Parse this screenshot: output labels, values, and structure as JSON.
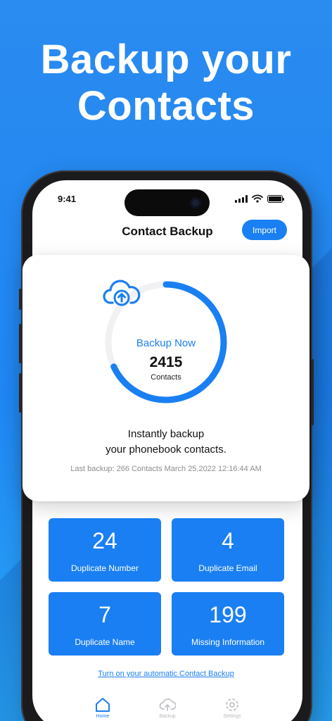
{
  "headline": {
    "line1": "Backup your",
    "line2": "Contacts"
  },
  "status_bar": {
    "time": "9:41"
  },
  "nav": {
    "title": "Contact Backup",
    "import_label": "Import"
  },
  "backup_card": {
    "action_label": "Backup Now",
    "count": "2415",
    "count_label": "Contacts",
    "progress_fraction": 0.68,
    "tagline_line1": "Instantly backup",
    "tagline_line2": "your phonebook contacts.",
    "last_backup": "Last backup: 266 Contacts March 25,2022 12:16:44 AM"
  },
  "stats": [
    {
      "value": "24",
      "label": "Duplicate Number"
    },
    {
      "value": "4",
      "label": "Duplicate Email"
    },
    {
      "value": "7",
      "label": "Duplicate Name"
    },
    {
      "value": "199",
      "label": "Missing Information"
    }
  ],
  "auto_backup_link": "Turn on your automatic Contact Backup",
  "tabs": [
    {
      "label": "Home",
      "icon": "home-icon"
    },
    {
      "label": "Backup",
      "icon": "cloud-upload-icon"
    },
    {
      "label": "Settings",
      "icon": "gear-icon"
    }
  ],
  "colors": {
    "accent": "#1a7ff2",
    "background": "#2a8bf0",
    "ring_track": "#f1f1f4"
  }
}
